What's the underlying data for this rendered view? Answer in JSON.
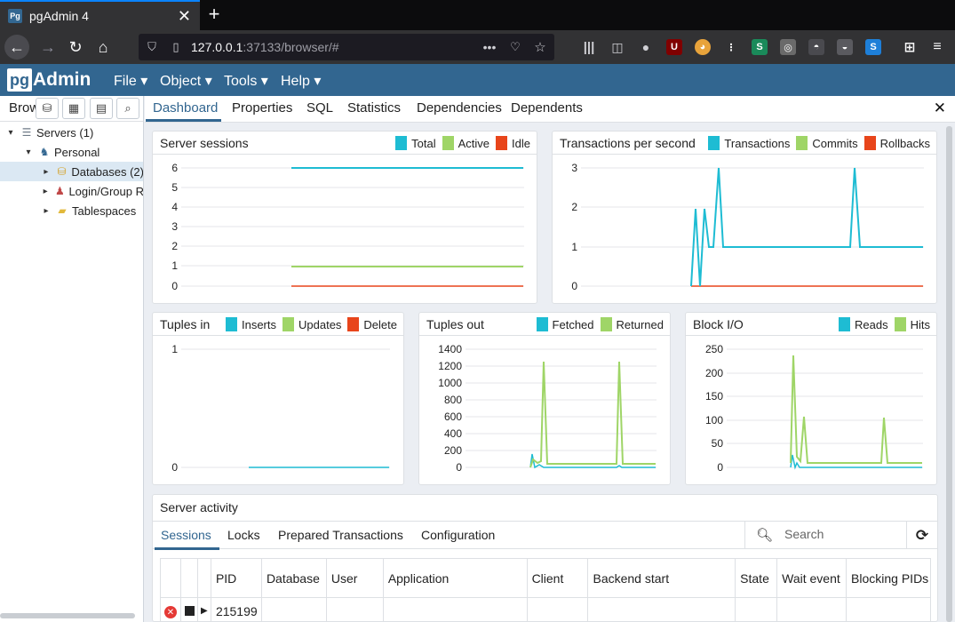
{
  "browser": {
    "tab_title": "pgAdmin 4",
    "url_host": "127.0.0.1",
    "url_rest": ":37133/browser/#"
  },
  "menubar": {
    "logo_pg": "pg",
    "logo_rest": "Admin",
    "items": [
      "File ▾",
      "Object ▾",
      "Tools ▾",
      "Help ▾"
    ]
  },
  "tree": {
    "panel_title": "Brow",
    "nodes": [
      {
        "label": "Servers (1)",
        "icon": "server-group-icon"
      },
      {
        "label": "Personal",
        "icon": "postgres-elephant-icon"
      },
      {
        "label": "Databases (2)",
        "icon": "databases-icon"
      },
      {
        "label": "Login/Group R",
        "icon": "roles-icon"
      },
      {
        "label": "Tablespaces",
        "icon": "folder-icon"
      }
    ]
  },
  "tabs": [
    "Dashboard",
    "Properties",
    "SQL",
    "Statistics",
    "Dependencies",
    "Dependents"
  ],
  "colors": {
    "teal": "#1ebcd3",
    "green": "#9fd567",
    "red": "#e8451b"
  },
  "charts": {
    "sessions": {
      "title": "Server sessions",
      "legend": [
        "Total",
        "Active",
        "Idle"
      ],
      "ticks": [
        "0",
        "1",
        "2",
        "3",
        "4",
        "5",
        "6"
      ]
    },
    "tps": {
      "title": "Transactions per second",
      "legend": [
        "Transactions",
        "Commits",
        "Rollbacks"
      ],
      "ticks": [
        "0",
        "1",
        "2",
        "3"
      ]
    },
    "tuples_in": {
      "title": "Tuples in",
      "legend": [
        "Inserts",
        "Updates",
        "Delete"
      ],
      "ticks": [
        "0",
        "1"
      ]
    },
    "tuples_out": {
      "title": "Tuples out",
      "legend": [
        "Fetched",
        "Returned"
      ],
      "ticks": [
        "0",
        "200",
        "400",
        "600",
        "800",
        "1000",
        "1200",
        "1400"
      ]
    },
    "block_io": {
      "title": "Block I/O",
      "legend": [
        "Reads",
        "Hits"
      ],
      "ticks": [
        "0",
        "50",
        "100",
        "150",
        "200",
        "250"
      ]
    }
  },
  "activity": {
    "title": "Server activity",
    "tabs": [
      "Sessions",
      "Locks",
      "Prepared Transactions",
      "Configuration"
    ],
    "search_placeholder": "Search",
    "columns": [
      "PID",
      "Database",
      "User",
      "Application",
      "Client",
      "Backend start",
      "State",
      "Wait event",
      "Blocking PIDs"
    ],
    "rows": [
      {
        "pid": "215199"
      }
    ]
  }
}
